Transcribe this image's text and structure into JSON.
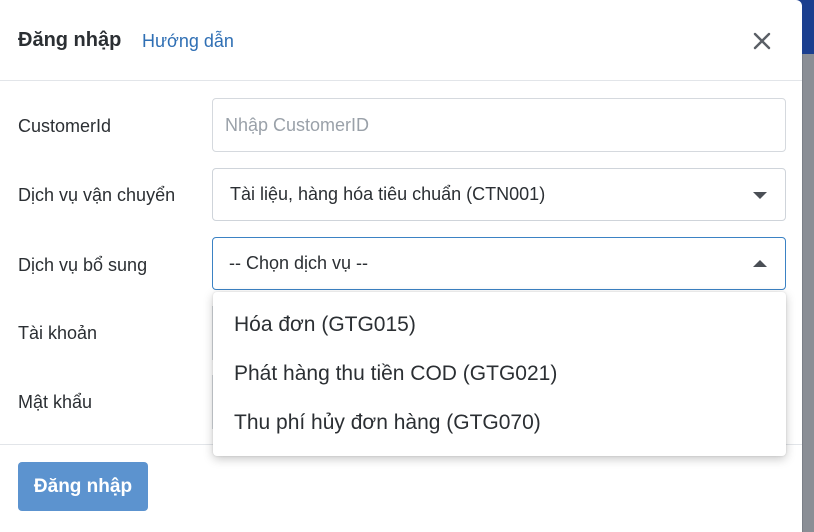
{
  "modal": {
    "title": "Đăng nhập",
    "guide_link": "Hướng dẫn",
    "close_icon": "close-icon"
  },
  "form": {
    "customer_id": {
      "label": "CustomerId",
      "placeholder": "Nhập CustomerID"
    },
    "shipping_service": {
      "label": "Dịch vụ vận chuyển",
      "selected": "Tài liệu, hàng hóa tiêu chuẩn (CTN001)"
    },
    "extra_service": {
      "label": "Dịch vụ bổ sung",
      "selected": "-- Chọn dịch vụ --",
      "options": [
        "Hóa đơn (GTG015)",
        "Phát hàng thu tiền COD (GTG021)",
        "Thu phí hủy đơn hàng (GTG070)"
      ]
    },
    "account": {
      "label": "Tài khoản"
    },
    "password": {
      "label": "Mật khẩu"
    }
  },
  "footer": {
    "login_button": "Đăng nhập"
  },
  "colors": {
    "link": "#2f6fb4",
    "primary_button": "#5c93cf",
    "focus_border": "#3b82c4",
    "backdrop_header": "#1b3f8f"
  }
}
